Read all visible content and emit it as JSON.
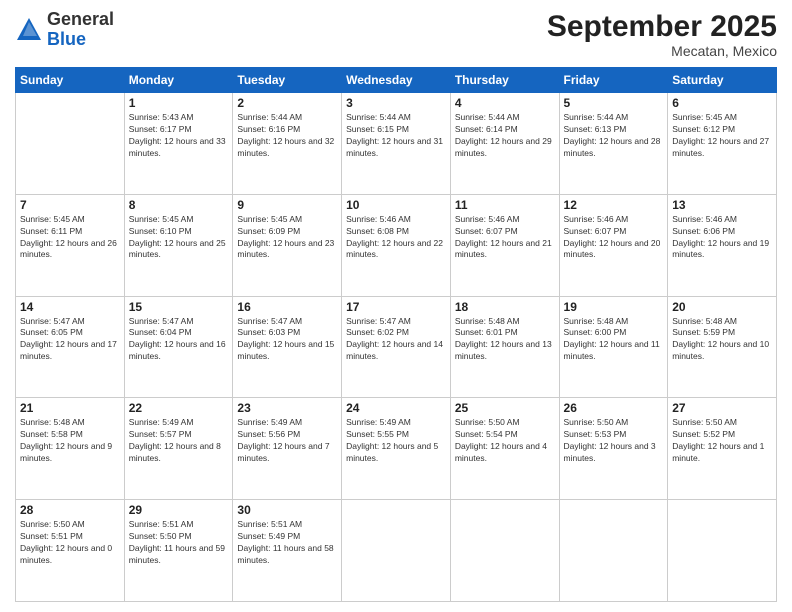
{
  "header": {
    "logo_general": "General",
    "logo_blue": "Blue",
    "month": "September 2025",
    "location": "Mecatan, Mexico"
  },
  "weekdays": [
    "Sunday",
    "Monday",
    "Tuesday",
    "Wednesday",
    "Thursday",
    "Friday",
    "Saturday"
  ],
  "weeks": [
    [
      {
        "day": "",
        "empty": true
      },
      {
        "day": "1",
        "sunrise": "Sunrise: 5:43 AM",
        "sunset": "Sunset: 6:17 PM",
        "daylight": "Daylight: 12 hours and 33 minutes."
      },
      {
        "day": "2",
        "sunrise": "Sunrise: 5:44 AM",
        "sunset": "Sunset: 6:16 PM",
        "daylight": "Daylight: 12 hours and 32 minutes."
      },
      {
        "day": "3",
        "sunrise": "Sunrise: 5:44 AM",
        "sunset": "Sunset: 6:15 PM",
        "daylight": "Daylight: 12 hours and 31 minutes."
      },
      {
        "day": "4",
        "sunrise": "Sunrise: 5:44 AM",
        "sunset": "Sunset: 6:14 PM",
        "daylight": "Daylight: 12 hours and 29 minutes."
      },
      {
        "day": "5",
        "sunrise": "Sunrise: 5:44 AM",
        "sunset": "Sunset: 6:13 PM",
        "daylight": "Daylight: 12 hours and 28 minutes."
      },
      {
        "day": "6",
        "sunrise": "Sunrise: 5:45 AM",
        "sunset": "Sunset: 6:12 PM",
        "daylight": "Daylight: 12 hours and 27 minutes."
      }
    ],
    [
      {
        "day": "7",
        "sunrise": "Sunrise: 5:45 AM",
        "sunset": "Sunset: 6:11 PM",
        "daylight": "Daylight: 12 hours and 26 minutes."
      },
      {
        "day": "8",
        "sunrise": "Sunrise: 5:45 AM",
        "sunset": "Sunset: 6:10 PM",
        "daylight": "Daylight: 12 hours and 25 minutes."
      },
      {
        "day": "9",
        "sunrise": "Sunrise: 5:45 AM",
        "sunset": "Sunset: 6:09 PM",
        "daylight": "Daylight: 12 hours and 23 minutes."
      },
      {
        "day": "10",
        "sunrise": "Sunrise: 5:46 AM",
        "sunset": "Sunset: 6:08 PM",
        "daylight": "Daylight: 12 hours and 22 minutes."
      },
      {
        "day": "11",
        "sunrise": "Sunrise: 5:46 AM",
        "sunset": "Sunset: 6:07 PM",
        "daylight": "Daylight: 12 hours and 21 minutes."
      },
      {
        "day": "12",
        "sunrise": "Sunrise: 5:46 AM",
        "sunset": "Sunset: 6:07 PM",
        "daylight": "Daylight: 12 hours and 20 minutes."
      },
      {
        "day": "13",
        "sunrise": "Sunrise: 5:46 AM",
        "sunset": "Sunset: 6:06 PM",
        "daylight": "Daylight: 12 hours and 19 minutes."
      }
    ],
    [
      {
        "day": "14",
        "sunrise": "Sunrise: 5:47 AM",
        "sunset": "Sunset: 6:05 PM",
        "daylight": "Daylight: 12 hours and 17 minutes."
      },
      {
        "day": "15",
        "sunrise": "Sunrise: 5:47 AM",
        "sunset": "Sunset: 6:04 PM",
        "daylight": "Daylight: 12 hours and 16 minutes."
      },
      {
        "day": "16",
        "sunrise": "Sunrise: 5:47 AM",
        "sunset": "Sunset: 6:03 PM",
        "daylight": "Daylight: 12 hours and 15 minutes."
      },
      {
        "day": "17",
        "sunrise": "Sunrise: 5:47 AM",
        "sunset": "Sunset: 6:02 PM",
        "daylight": "Daylight: 12 hours and 14 minutes."
      },
      {
        "day": "18",
        "sunrise": "Sunrise: 5:48 AM",
        "sunset": "Sunset: 6:01 PM",
        "daylight": "Daylight: 12 hours and 13 minutes."
      },
      {
        "day": "19",
        "sunrise": "Sunrise: 5:48 AM",
        "sunset": "Sunset: 6:00 PM",
        "daylight": "Daylight: 12 hours and 11 minutes."
      },
      {
        "day": "20",
        "sunrise": "Sunrise: 5:48 AM",
        "sunset": "Sunset: 5:59 PM",
        "daylight": "Daylight: 12 hours and 10 minutes."
      }
    ],
    [
      {
        "day": "21",
        "sunrise": "Sunrise: 5:48 AM",
        "sunset": "Sunset: 5:58 PM",
        "daylight": "Daylight: 12 hours and 9 minutes."
      },
      {
        "day": "22",
        "sunrise": "Sunrise: 5:49 AM",
        "sunset": "Sunset: 5:57 PM",
        "daylight": "Daylight: 12 hours and 8 minutes."
      },
      {
        "day": "23",
        "sunrise": "Sunrise: 5:49 AM",
        "sunset": "Sunset: 5:56 PM",
        "daylight": "Daylight: 12 hours and 7 minutes."
      },
      {
        "day": "24",
        "sunrise": "Sunrise: 5:49 AM",
        "sunset": "Sunset: 5:55 PM",
        "daylight": "Daylight: 12 hours and 5 minutes."
      },
      {
        "day": "25",
        "sunrise": "Sunrise: 5:50 AM",
        "sunset": "Sunset: 5:54 PM",
        "daylight": "Daylight: 12 hours and 4 minutes."
      },
      {
        "day": "26",
        "sunrise": "Sunrise: 5:50 AM",
        "sunset": "Sunset: 5:53 PM",
        "daylight": "Daylight: 12 hours and 3 minutes."
      },
      {
        "day": "27",
        "sunrise": "Sunrise: 5:50 AM",
        "sunset": "Sunset: 5:52 PM",
        "daylight": "Daylight: 12 hours and 1 minute."
      }
    ],
    [
      {
        "day": "28",
        "sunrise": "Sunrise: 5:50 AM",
        "sunset": "Sunset: 5:51 PM",
        "daylight": "Daylight: 12 hours and 0 minutes."
      },
      {
        "day": "29",
        "sunrise": "Sunrise: 5:51 AM",
        "sunset": "Sunset: 5:50 PM",
        "daylight": "Daylight: 11 hours and 59 minutes."
      },
      {
        "day": "30",
        "sunrise": "Sunrise: 5:51 AM",
        "sunset": "Sunset: 5:49 PM",
        "daylight": "Daylight: 11 hours and 58 minutes."
      },
      {
        "day": "",
        "empty": true
      },
      {
        "day": "",
        "empty": true
      },
      {
        "day": "",
        "empty": true
      },
      {
        "day": "",
        "empty": true
      }
    ]
  ]
}
